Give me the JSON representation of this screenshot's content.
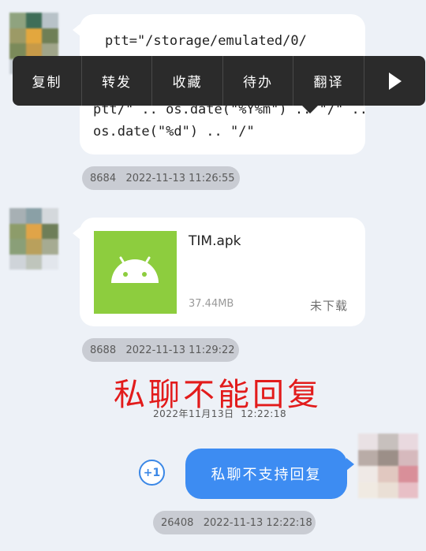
{
  "colors": {
    "background": "#edf1f7",
    "menu_bg": "#2b2b2b",
    "apk_tile": "#8dcd3e",
    "outgoing_bubble": "#3d8cf2",
    "annotation_red": "#e21b1b",
    "timestamp_pill": "#c9ccd3"
  },
  "context_menu": {
    "items": [
      {
        "label": "复制"
      },
      {
        "label": "转发"
      },
      {
        "label": "收藏"
      },
      {
        "label": "待办"
      },
      {
        "label": "翻译"
      }
    ],
    "more_icon": "play-triangle-icon"
  },
  "messages": {
    "m1": {
      "line1": "ptt=\"/storage/emulated/0/",
      "line2": "ptt/\" .. os.date(\"%Y%m\") .. \"/\" ..",
      "line3": "os.date(\"%d\") .. \"/\"",
      "meta": "8684   2022-11-13 11:26:55"
    },
    "m2": {
      "file_name": "TIM.apk",
      "file_size": "37.44MB",
      "status": "未下载",
      "file_icon": "android-icon",
      "meta": "8688   2022-11-13 11:29:22"
    },
    "annotation": {
      "text": "私聊不能回复",
      "date": "2022年11月13日  12:22:18"
    },
    "m3": {
      "text": "私聊不支持回复",
      "plus_badge": "+1",
      "meta": "26408   2022-11-13 12:22:18"
    }
  }
}
